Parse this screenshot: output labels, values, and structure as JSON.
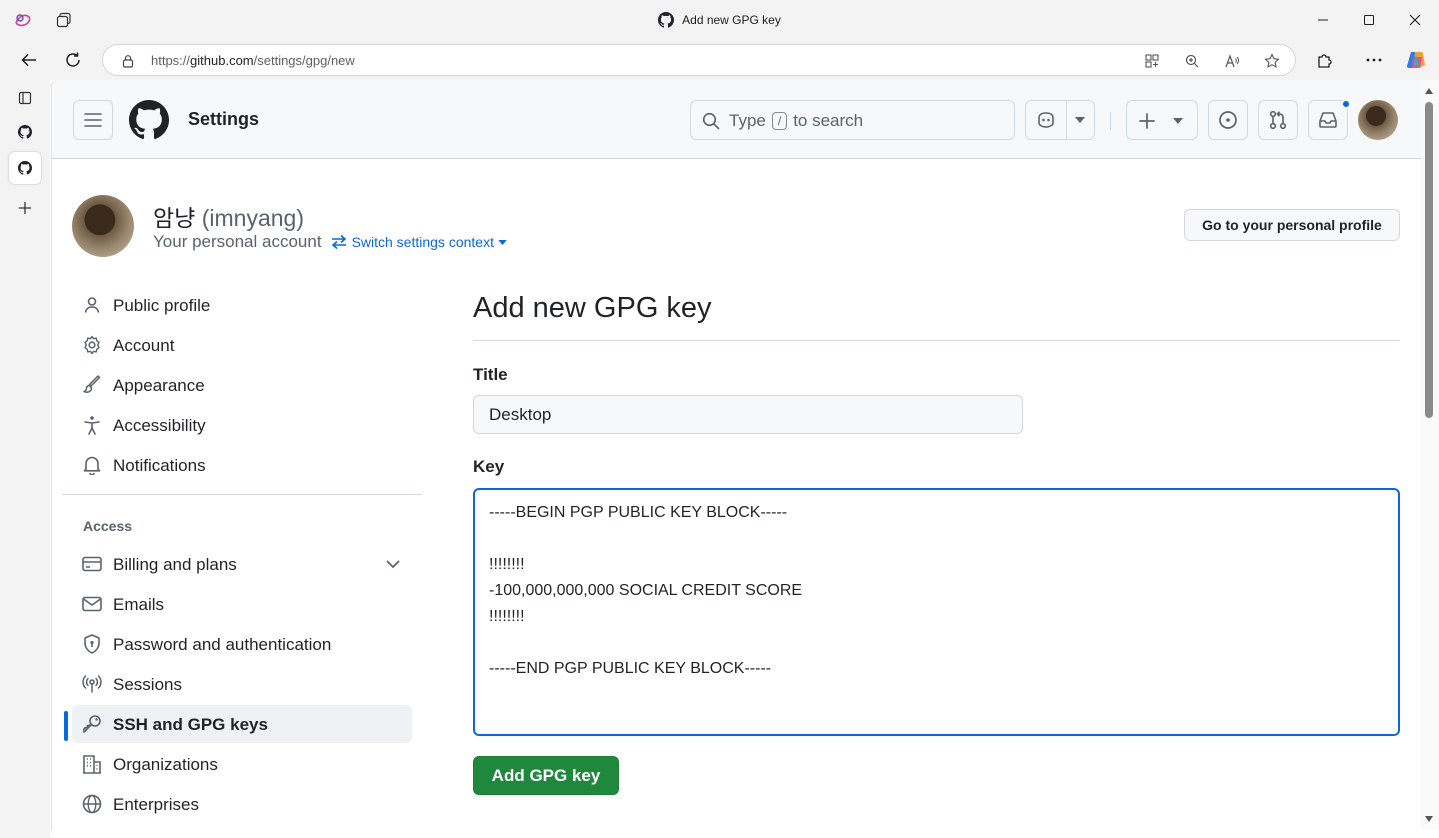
{
  "window": {
    "title": "Add new GPG key"
  },
  "browser": {
    "url_scheme": "https://",
    "url_host": "github.com",
    "url_path": "/settings/gpg/new"
  },
  "header": {
    "title": "Settings",
    "search_prefix": "Type",
    "search_key": "/",
    "search_suffix": "to search"
  },
  "context": {
    "display_name": "암냥",
    "login": "(imnyang)",
    "account_type": "Your personal account",
    "switch_label": "Switch settings context",
    "profile_button": "Go to your personal profile"
  },
  "sidebar": {
    "items": [
      {
        "label": "Public profile",
        "icon": "person-icon"
      },
      {
        "label": "Account",
        "icon": "gear-icon"
      },
      {
        "label": "Appearance",
        "icon": "paintbrush-icon"
      },
      {
        "label": "Accessibility",
        "icon": "accessibility-icon"
      },
      {
        "label": "Notifications",
        "icon": "bell-icon"
      }
    ],
    "access_heading": "Access",
    "access_items": [
      {
        "label": "Billing and plans",
        "icon": "credit-card-icon"
      },
      {
        "label": "Emails",
        "icon": "mail-icon"
      },
      {
        "label": "Password and authentication",
        "icon": "shield-lock-icon"
      },
      {
        "label": "Sessions",
        "icon": "broadcast-icon"
      },
      {
        "label": "SSH and GPG keys",
        "icon": "key-icon",
        "active": true
      },
      {
        "label": "Organizations",
        "icon": "organization-icon"
      },
      {
        "label": "Enterprises",
        "icon": "globe-icon"
      }
    ]
  },
  "form": {
    "page_title": "Add new GPG key",
    "title_label": "Title",
    "title_value": "Desktop",
    "key_label": "Key",
    "key_value": "-----BEGIN PGP PUBLIC KEY BLOCK-----\n\n!!!!!!!!\n-100,000,000,000 SOCIAL CREDIT SCORE\n!!!!!!!!\n\n-----END PGP PUBLIC KEY BLOCK-----",
    "submit_label": "Add GPG key"
  },
  "colors": {
    "accent": "#0969da",
    "primary_button": "#1f883d",
    "border": "#d1d9e0",
    "muted_text": "#59636e"
  }
}
